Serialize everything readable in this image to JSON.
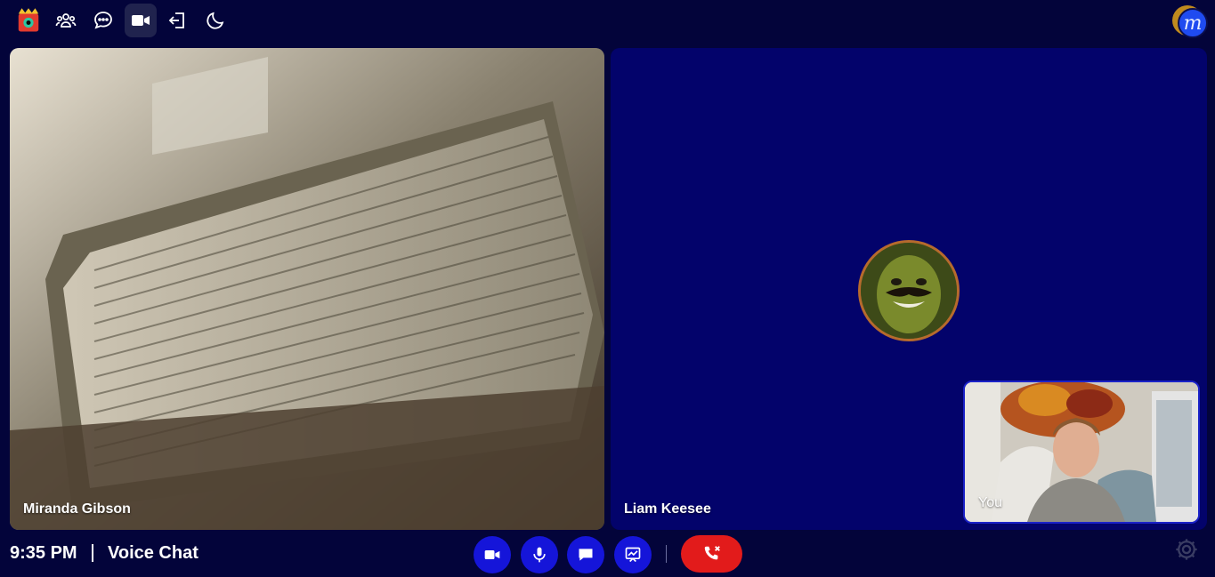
{
  "app": {
    "title": "Voice Chat",
    "time": "9:35 PM",
    "user_initial": "m"
  },
  "topbar": {
    "icons": [
      "app-logo-icon",
      "people-icon",
      "chat-bubble-icon",
      "video-camera-icon",
      "exit-icon",
      "moon-icon"
    ],
    "active": "video-camera-icon"
  },
  "participants": [
    {
      "name": "Miranda Gibson",
      "video": true
    },
    {
      "name": "Liam Keesee",
      "video": false
    }
  ],
  "self_view": {
    "label": "You"
  },
  "controls": [
    "video-camera-icon",
    "microphone-icon",
    "chat-bubble-icon",
    "screen-share-icon",
    "hang-up-icon"
  ],
  "colors": {
    "background": "#03043a",
    "tile_blue": "#03036b",
    "control_blue": "#1515d9",
    "hangup_red": "#e21b1b",
    "avatar_ring": "#b66a2d"
  }
}
